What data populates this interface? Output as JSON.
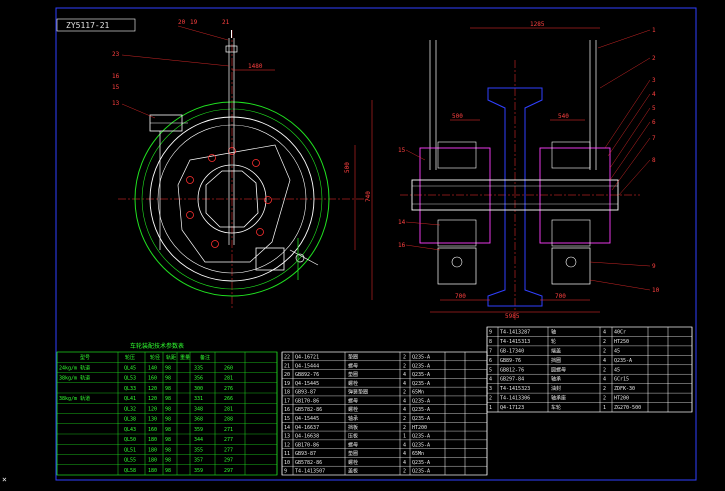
{
  "drawing_code": "ZY5117-21",
  "colors": {
    "background": "#000000",
    "frame": "#3040ff",
    "outline": "#ffffff",
    "dimension": "#ff3030",
    "green": "#20e020",
    "magenta": "#ff40ff",
    "center_line": "#ff3030"
  },
  "front_view_callouts": [
    "23",
    "16",
    "13",
    "15",
    "20",
    "19",
    "21"
  ],
  "front_view_dims": [
    "1480",
    "500",
    "740"
  ],
  "side_view_callouts": [
    "14",
    "15",
    "16",
    "1",
    "2",
    "3",
    "4",
    "5",
    "6",
    "7",
    "8",
    "9",
    "10"
  ],
  "side_view_dims": [
    "1285",
    "500",
    "540",
    "700",
    "700",
    "5985"
  ],
  "parts_list_title": "车轮装配明细表",
  "parts_list_rows": [
    {
      "no": "22",
      "code": "Q4-16721",
      "name": "垫圈",
      "qty": "2",
      "mat": "Q235-A"
    },
    {
      "no": "21",
      "code": "Q4-15444",
      "name": "螺母",
      "qty": "2",
      "mat": "Q235-A"
    },
    {
      "no": "20",
      "code": "GB892-76",
      "name": "垫圈",
      "qty": "4",
      "mat": "Q235-A"
    },
    {
      "no": "19",
      "code": "Q4-15445",
      "name": "螺栓",
      "qty": "4",
      "mat": "Q235-A"
    },
    {
      "no": "18",
      "code": "GB93-87",
      "name": "弹簧垫圈",
      "qty": "2",
      "mat": "65Mn"
    },
    {
      "no": "17",
      "code": "GB170-86",
      "name": "螺母",
      "qty": "4",
      "mat": "Q235-A"
    },
    {
      "no": "16",
      "code": "GB5782-86",
      "name": "螺栓",
      "qty": "4",
      "mat": "Q235-A"
    },
    {
      "no": "15",
      "code": "Q4-15445",
      "name": "轴承",
      "qty": "2",
      "mat": "Q235-A"
    },
    {
      "no": "14",
      "code": "Q4-16637",
      "name": "挡板",
      "qty": "2",
      "mat": "HT200"
    },
    {
      "no": "13",
      "code": "Q4-16638",
      "name": "压板",
      "qty": "1",
      "mat": "Q235-A"
    },
    {
      "no": "12",
      "code": "GB170-86",
      "name": "螺母",
      "qty": "4",
      "mat": "Q235-A"
    },
    {
      "no": "11",
      "code": "GB93-87",
      "name": "垫圈",
      "qty": "4",
      "mat": "65Mn"
    },
    {
      "no": "10",
      "code": "GB5782-86",
      "name": "螺栓",
      "qty": "4",
      "mat": "Q235-A"
    },
    {
      "no": "9",
      "code": "T4-1413507",
      "name": "盖板",
      "qty": "2",
      "mat": "Q235-A"
    }
  ],
  "material_rows": [
    {
      "no": "9",
      "code": "T4-1413287",
      "name": "轴",
      "qty": "4",
      "mat": "40Cr"
    },
    {
      "no": "8",
      "code": "T4-1415313",
      "name": "轮",
      "qty": "2",
      "mat": "HT250"
    },
    {
      "no": "7",
      "code": "GB-17340",
      "name": "端盖",
      "qty": "2",
      "mat": "45"
    },
    {
      "no": "6",
      "code": "GB89-76",
      "name": "挡圈",
      "qty": "4",
      "mat": "Q235-A"
    },
    {
      "no": "5",
      "code": "GB812-76",
      "name": "圆螺母",
      "qty": "2",
      "mat": "45"
    },
    {
      "no": "4",
      "code": "GB297-84",
      "name": "轴承",
      "qty": "4",
      "mat": "GCr15"
    },
    {
      "no": "3",
      "code": "T4-1415323",
      "name": "油封",
      "qty": "2",
      "mat": "ZDFK-30"
    },
    {
      "no": "2",
      "code": "T4-1413306",
      "name": "轴承座",
      "qty": "2",
      "mat": "HT200"
    },
    {
      "no": "1",
      "code": "Q4-17123",
      "name": "车轮",
      "qty": "1",
      "mat": "ZG270-500"
    }
  ],
  "spec_table_title": "车轮装配技术参数表",
  "spec_headers": [
    "型号",
    "轮压",
    "轮径",
    "轨距",
    "重量",
    "备注"
  ],
  "spec_rows": [
    {
      "label": "24kg/m 轨道",
      "model": "QL45",
      "d": "140",
      "w": "98",
      "a": "335",
      "b": "260"
    },
    {
      "label": "38kg/m 轨道",
      "model": "QL53",
      "d": "160",
      "w": "98",
      "a": "356",
      "b": "281"
    },
    {
      "label": "",
      "model": "QL33",
      "d": "120",
      "w": "98",
      "a": "300",
      "b": "276"
    },
    {
      "label": "38kg/m 轨道",
      "model": "QL41",
      "d": "120",
      "w": "98",
      "a": "331",
      "b": "266"
    },
    {
      "label": "",
      "model": "QL32",
      "d": "120",
      "w": "98",
      "a": "348",
      "b": "281"
    },
    {
      "label": "",
      "model": "QL38",
      "d": "130",
      "w": "98",
      "a": "368",
      "b": "288"
    },
    {
      "label": "",
      "model": "QL43",
      "d": "160",
      "w": "98",
      "a": "359",
      "b": "271"
    },
    {
      "label": "",
      "model": "QL50",
      "d": "180",
      "w": "98",
      "a": "344",
      "b": "277"
    },
    {
      "label": "",
      "model": "QL51",
      "d": "180",
      "w": "98",
      "a": "355",
      "b": "277"
    },
    {
      "label": "",
      "model": "QL55",
      "d": "180",
      "w": "98",
      "a": "357",
      "b": "297"
    },
    {
      "label": "",
      "model": "QL58",
      "d": "180",
      "w": "98",
      "a": "359",
      "b": "297"
    }
  ]
}
